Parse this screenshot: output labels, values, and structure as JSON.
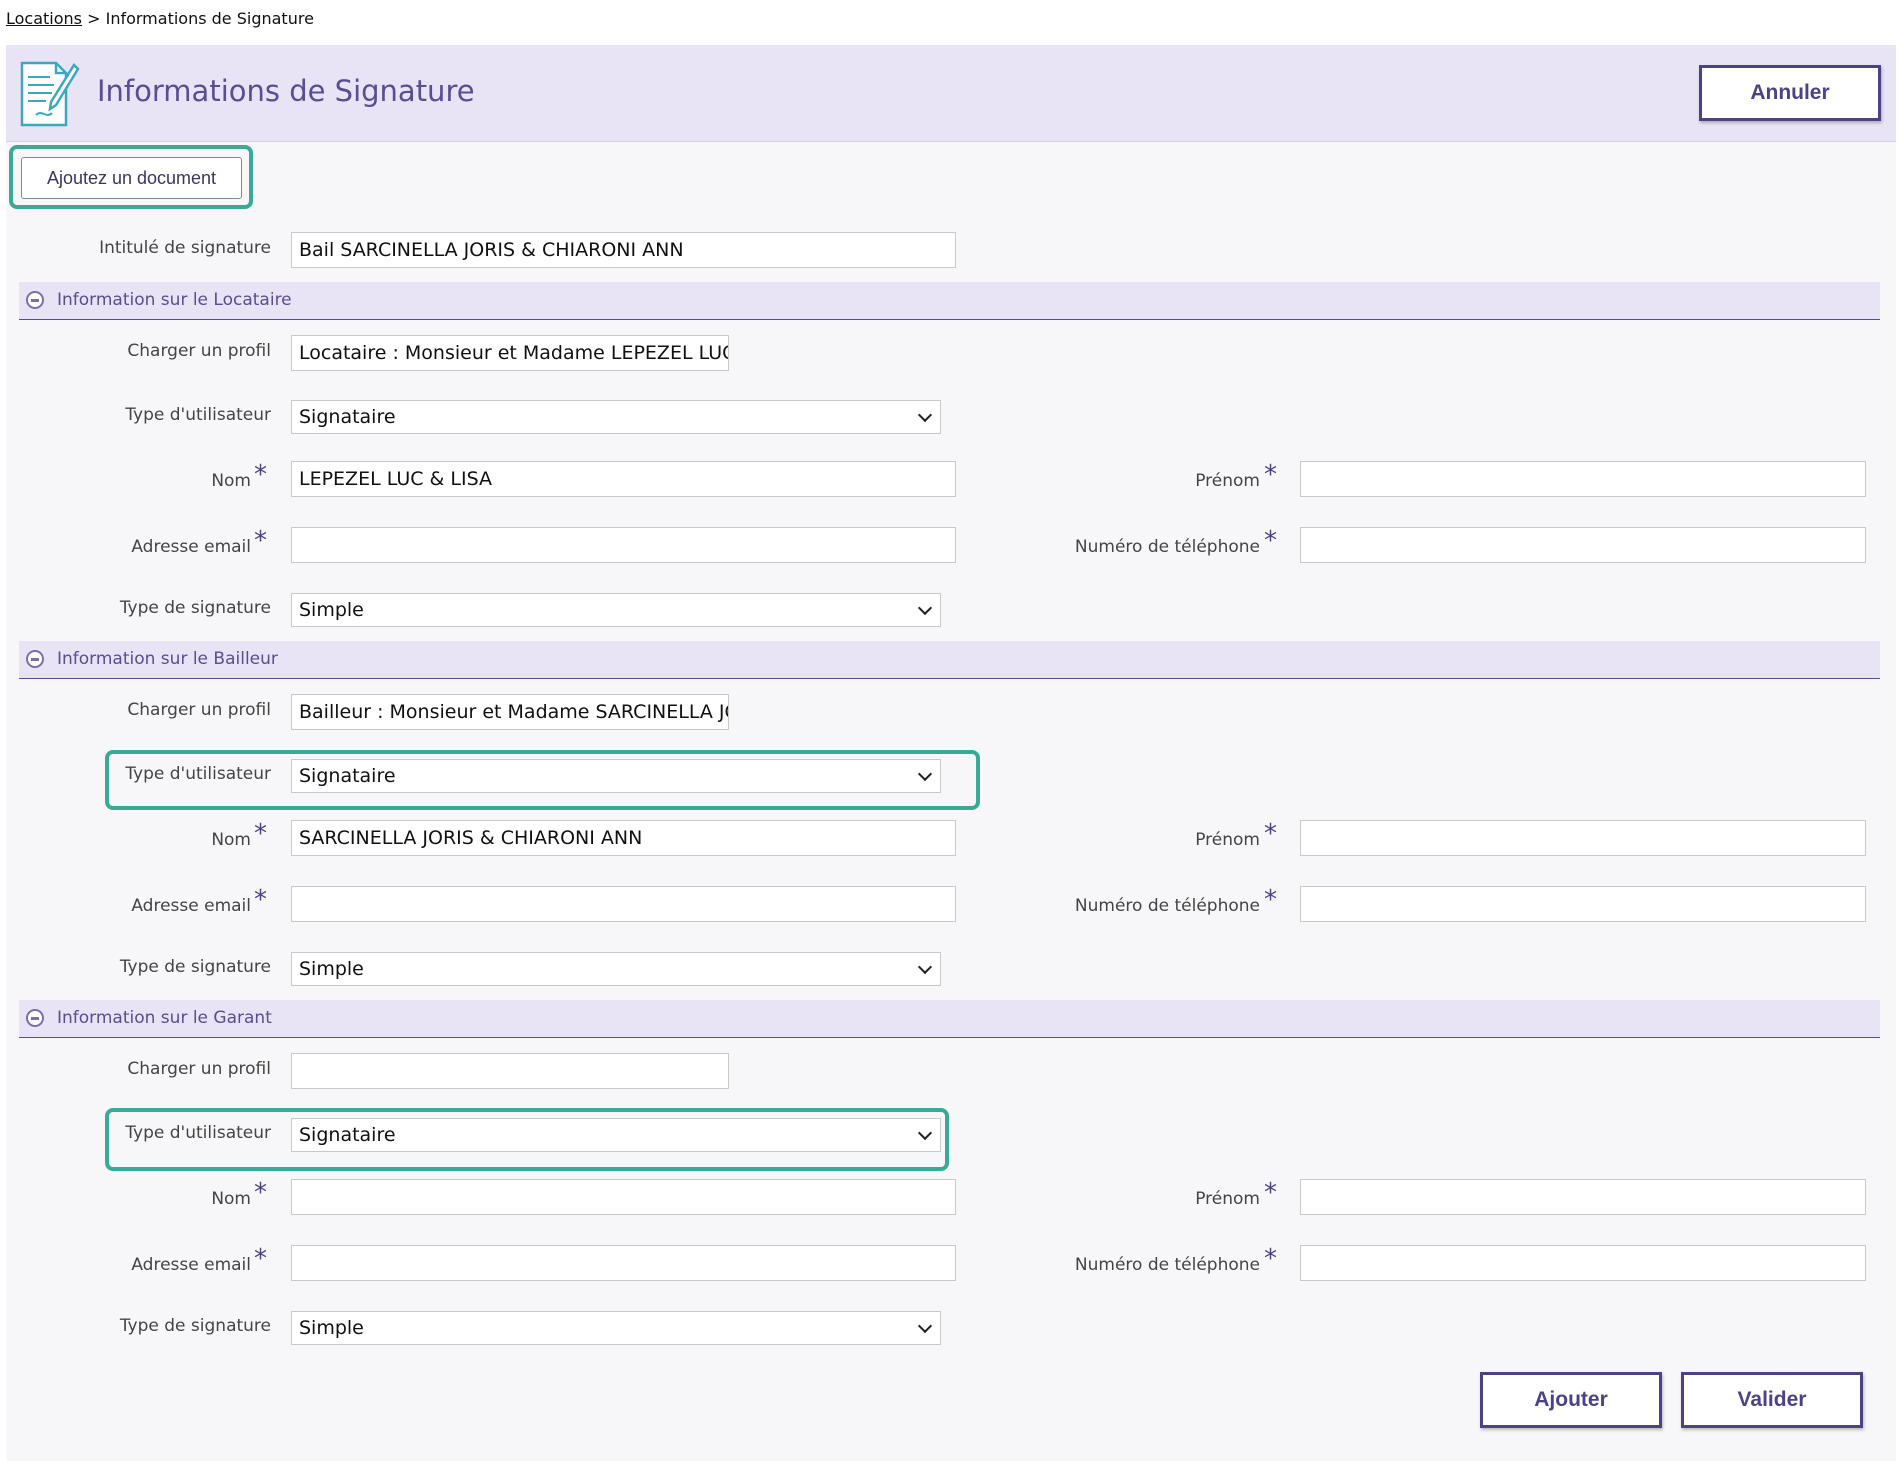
{
  "breadcrumb": {
    "link": "Locations",
    "separator": " > ",
    "current": "Informations de Signature"
  },
  "header": {
    "title": "Informations de Signature",
    "icon": "document-signature-icon",
    "cancel_label": "Annuler"
  },
  "add_document_label": "Ajoutez un document",
  "signature_title": {
    "label": "Intitulé de signature",
    "value": "Bail SARCINELLA JORIS & CHIARONI ANN"
  },
  "sections": [
    {
      "title": "Information sur le Locataire",
      "profile_label": "Charger un profil",
      "profile_value": "Locataire : Monsieur et Madame LEPEZEL LUC",
      "user_type_label": "Type d'utilisateur",
      "user_type_value": "Signataire",
      "nom_label": "Nom",
      "nom_value": "LEPEZEL LUC & LISA",
      "prenom_label": "Prénom",
      "prenom_value": "",
      "email_label": "Adresse email",
      "email_value": "",
      "phone_label": "Numéro de téléphone",
      "phone_value": "",
      "sig_type_label": "Type de signature",
      "sig_type_value": "Simple"
    },
    {
      "title": "Information sur le Bailleur",
      "profile_label": "Charger un profil",
      "profile_value": "Bailleur : Monsieur et Madame SARCINELLA JC",
      "user_type_label": "Type d'utilisateur",
      "user_type_value": "Signataire",
      "nom_label": "Nom",
      "nom_value": "SARCINELLA JORIS & CHIARONI ANN",
      "prenom_label": "Prénom",
      "prenom_value": "",
      "email_label": "Adresse email",
      "email_value": "",
      "phone_label": "Numéro de téléphone",
      "phone_value": "",
      "sig_type_label": "Type de signature",
      "sig_type_value": "Simple"
    },
    {
      "title": "Information sur le Garant",
      "profile_label": "Charger un profil",
      "profile_value": "",
      "user_type_label": "Type d'utilisateur",
      "user_type_value": "Signataire",
      "nom_label": "Nom",
      "nom_value": "",
      "prenom_label": "Prénom",
      "prenom_value": "",
      "email_label": "Adresse email",
      "email_value": "",
      "phone_label": "Numéro de téléphone",
      "phone_value": "",
      "sig_type_label": "Type de signature",
      "sig_type_value": "Simple"
    }
  ],
  "required_mark": "*",
  "footer": {
    "add_label": "Ajouter",
    "validate_label": "Valider"
  },
  "colors": {
    "accent": "#4e4287",
    "header_bg": "#e8e3f5",
    "highlight": "#3aaa96"
  }
}
